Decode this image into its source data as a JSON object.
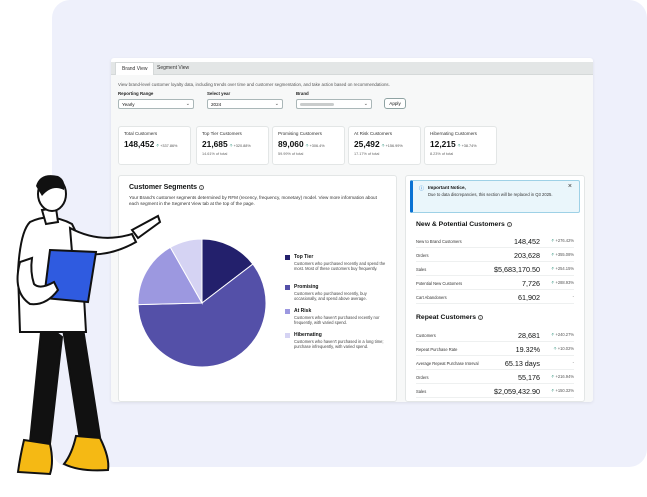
{
  "tabs": [
    "Brand View",
    "Segment View"
  ],
  "description": "View brand-level customer loyalty data, including trends over time and customer segmentation, and take action based on recommendations.",
  "filters": [
    {
      "label": "Reporting Range",
      "value": "Yearly"
    },
    {
      "label": "Select year",
      "value": "2024"
    },
    {
      "label": "Brand",
      "value": ""
    }
  ],
  "apply_label": "Apply",
  "cards": [
    {
      "title": "Total Customers",
      "value": "148,452",
      "delta": "+337.86%",
      "sub": ""
    },
    {
      "title": "Top Tier Customers",
      "value": "21,685",
      "delta": "+320.88%",
      "sub": "14.61% of total"
    },
    {
      "title": "Promising Customers",
      "value": "89,060",
      "delta": "+306.4%",
      "sub": "59.99% of total"
    },
    {
      "title": "At Risk Customers",
      "value": "25,492",
      "delta": "+156.99%",
      "sub": "17.17% of total"
    },
    {
      "title": "Hibernating Customers",
      "value": "12,215",
      "delta": "+38.74%",
      "sub": "8.23% of total"
    }
  ],
  "segments": {
    "title": "Customer Segments",
    "description": "Your Brand's customer segments determined by RFM (recency, frequency, monetary) model. View more information about each segment in the Segment View tab at the top of the page.",
    "legend": [
      {
        "name": "Top Tier",
        "desc": "Customers who purchased recently and spend the most. Most of these customers buy frequently.",
        "color": "#23206c"
      },
      {
        "name": "Promising",
        "desc": "Customers who purchased recently, buy occasionally, and spend above average.",
        "color": "#5450a8"
      },
      {
        "name": "At Risk",
        "desc": "Customers who haven't purchased recently nor frequently, with varied spend.",
        "color": "#9c98e0"
      },
      {
        "name": "Hibernating",
        "desc": "Customers who haven't purchased in a long time; purchase infrequently, with varied spend.",
        "color": "#d5d3f3"
      }
    ],
    "shares": [
      14.61,
      59.99,
      17.17,
      8.23
    ]
  },
  "notice": {
    "title": "Important Notice,",
    "body": "Due to data discrepancies, this section will be replaced in Q3 2025.",
    "close": "×"
  },
  "new_potential": {
    "title": "New & Potential Customers",
    "rows": [
      {
        "label": "New to Brand Customers",
        "value": "148,452",
        "delta": "+276.42%"
      },
      {
        "label": "Orders",
        "value": "203,628",
        "delta": "+355.08%"
      },
      {
        "label": "Sales",
        "value": "$5,683,170.50",
        "delta": "+254.15%"
      },
      {
        "label": "Potential New Customers",
        "value": "7,726",
        "delta": "+288.93%"
      },
      {
        "label": "Cart Abandoners",
        "value": "61,902",
        "delta": "-"
      }
    ]
  },
  "repeat": {
    "title": "Repeat Customers",
    "rows": [
      {
        "label": "Customers",
        "value": "28,681",
        "delta": "+240.27%"
      },
      {
        "label": "Repeat Purchase Rate",
        "value": "19.32%",
        "delta": "+10.02%"
      },
      {
        "label": "Average Repeat Purchase Interval",
        "value": "65.13 days",
        "delta": "-"
      },
      {
        "label": "Orders",
        "value": "55,176",
        "delta": "+216.94%"
      },
      {
        "label": "Sales",
        "value": "$2,059,432.90",
        "delta": "+150.32%"
      }
    ]
  }
}
